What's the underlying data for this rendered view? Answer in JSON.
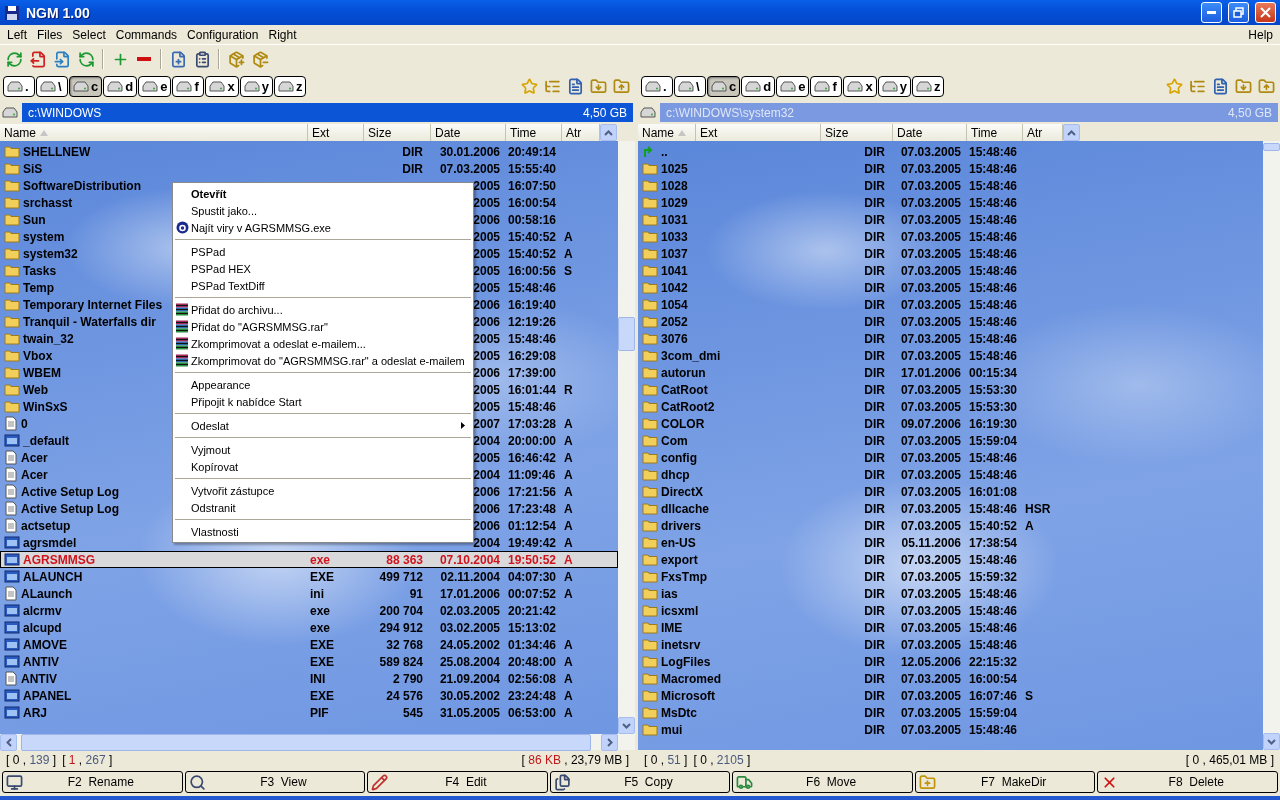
{
  "window": {
    "title": "NGM 1.00"
  },
  "menu": {
    "left": [
      "Left",
      "Files",
      "Select",
      "Commands",
      "Configuration",
      "Right"
    ],
    "right": [
      "Help"
    ]
  },
  "panes": [
    {
      "active": true,
      "path": "c:\\WINDOWS",
      "free": "4,50 GB",
      "drives": [
        {
          "label": ".",
          "selected": false
        },
        {
          "label": "\\",
          "selected": false
        },
        {
          "label": "c",
          "selected": true
        },
        {
          "label": "d",
          "selected": false
        },
        {
          "label": "e",
          "selected": false
        },
        {
          "label": "f",
          "selected": false
        },
        {
          "label": "x",
          "selected": false
        },
        {
          "label": "y",
          "selected": false
        },
        {
          "label": "z",
          "selected": false
        }
      ],
      "columns": [
        {
          "label": "Name",
          "sorted": true
        },
        {
          "label": "Ext",
          "sorted": false
        },
        {
          "label": "Size",
          "sorted": false
        },
        {
          "label": "Date",
          "sorted": false
        },
        {
          "label": "Time",
          "sorted": false
        },
        {
          "label": "Atr",
          "sorted": false
        }
      ],
      "rows": [
        {
          "kind": "folder",
          "name": "SHELLNEW",
          "size": "DIR",
          "date": "30.01.2006",
          "time": "20:49:14",
          "selected": false
        },
        {
          "kind": "folder",
          "name": "SiS",
          "size": "DIR",
          "date": "07.03.2005",
          "time": "15:55:40",
          "selected": false
        },
        {
          "kind": "folder",
          "name": "SoftwareDistribution",
          "date": "2005",
          "time": "16:07:50",
          "selected": false
        },
        {
          "kind": "folder",
          "name": "srchasst",
          "date": "2005",
          "time": "16:00:54",
          "selected": false
        },
        {
          "kind": "folder",
          "name": "Sun",
          "date": "2006",
          "time": "00:58:16",
          "selected": false
        },
        {
          "kind": "folder",
          "name": "system",
          "date": "2005",
          "time": "15:40:52",
          "attr": "A",
          "selected": false
        },
        {
          "kind": "folder",
          "name": "system32",
          "date": "2005",
          "time": "15:40:52",
          "attr": "A",
          "selected": false
        },
        {
          "kind": "folder",
          "name": "Tasks",
          "date": "2005",
          "time": "16:00:56",
          "attr": "S",
          "selected": false
        },
        {
          "kind": "folder",
          "name": "Temp",
          "date": "2005",
          "time": "15:48:46",
          "selected": false
        },
        {
          "kind": "folder",
          "name": "Temporary Internet Files",
          "date": "2006",
          "time": "16:19:40",
          "selected": false
        },
        {
          "kind": "folder",
          "name": "Tranquil - Waterfalls dir",
          "date": "2006",
          "time": "12:19:26",
          "selected": false
        },
        {
          "kind": "folder",
          "name": "twain_32",
          "date": "2005",
          "time": "15:48:46",
          "selected": false
        },
        {
          "kind": "folder",
          "name": "Vbox",
          "date": "2005",
          "time": "16:29:08",
          "selected": false
        },
        {
          "kind": "folder",
          "name": "WBEM",
          "date": "2006",
          "time": "17:39:00",
          "selected": false
        },
        {
          "kind": "folder",
          "name": "Web",
          "date": "2005",
          "time": "16:01:44",
          "attr": "R",
          "selected": false
        },
        {
          "kind": "folder",
          "name": "WinSxS",
          "date": "2005",
          "time": "15:48:46",
          "selected": false
        },
        {
          "kind": "file",
          "name": "0",
          "date": "2007",
          "time": "17:03:28",
          "attr": "A",
          "selected": false
        },
        {
          "kind": "app",
          "name": "_default",
          "date": "2004",
          "time": "20:00:00",
          "attr": "A",
          "selected": false
        },
        {
          "kind": "file",
          "name": "Acer",
          "date": "2005",
          "time": "16:46:42",
          "attr": "A",
          "selected": false
        },
        {
          "kind": "file",
          "name": "Acer",
          "date": "2004",
          "time": "11:09:46",
          "attr": "A",
          "selected": false
        },
        {
          "kind": "file",
          "name": "Active Setup Log",
          "date": "2006",
          "time": "17:21:56",
          "attr": "A",
          "selected": false
        },
        {
          "kind": "file",
          "name": "Active Setup Log",
          "date": "2006",
          "time": "17:23:48",
          "attr": "A",
          "selected": false
        },
        {
          "kind": "file",
          "name": "actsetup",
          "date": "2006",
          "time": "01:12:54",
          "attr": "A",
          "selected": false
        },
        {
          "kind": "app",
          "name": "agrsmdel",
          "date": "2004",
          "time": "19:49:42",
          "attr": "A",
          "selected": false
        },
        {
          "kind": "app",
          "name": "AGRSMMSG",
          "ext": "exe",
          "size": "88 363",
          "date": "07.10.2004",
          "time": "19:50:52",
          "attr": "A",
          "selected": true
        },
        {
          "kind": "app",
          "name": "ALAUNCH",
          "ext": "EXE",
          "size": "499 712",
          "date": "02.11.2004",
          "time": "04:07:30",
          "attr": "A",
          "selected": false
        },
        {
          "kind": "file",
          "name": "ALaunch",
          "ext": "ini",
          "size": "91",
          "date": "17.01.2006",
          "time": "00:07:52",
          "attr": "A",
          "selected": false
        },
        {
          "kind": "app",
          "name": "alcrmv",
          "ext": "exe",
          "size": "200 704",
          "date": "02.03.2005",
          "time": "20:21:42",
          "selected": false
        },
        {
          "kind": "app",
          "name": "alcupd",
          "ext": "exe",
          "size": "294 912",
          "date": "03.02.2005",
          "time": "15:13:02",
          "selected": false
        },
        {
          "kind": "app",
          "name": "AMOVE",
          "ext": "EXE",
          "size": "32 768",
          "date": "24.05.2002",
          "time": "01:34:46",
          "attr": "A",
          "selected": false
        },
        {
          "kind": "app",
          "name": "ANTIV",
          "ext": "EXE",
          "size": "589 824",
          "date": "25.08.2004",
          "time": "20:48:00",
          "attr": "A",
          "selected": false
        },
        {
          "kind": "file",
          "name": "ANTIV",
          "ext": "INI",
          "size": "2 790",
          "date": "21.09.2004",
          "time": "02:56:08",
          "attr": "A",
          "selected": false
        },
        {
          "kind": "app",
          "name": "APANEL",
          "ext": "EXE",
          "size": "24 576",
          "date": "30.05.2002",
          "time": "23:24:48",
          "attr": "A",
          "selected": false
        },
        {
          "kind": "app",
          "name": "ARJ",
          "ext": "PIF",
          "size": "545",
          "date": "31.05.2005",
          "time": "06:53:00",
          "attr": "A",
          "selected": false
        }
      ],
      "counters": [
        {
          "parts": [
            "[",
            "0",
            ",",
            "139",
            "]"
          ],
          "marked": false
        },
        {
          "parts": [
            "[",
            "1",
            ",",
            "267",
            "]"
          ],
          "marked": true
        }
      ],
      "totals": {
        "parts": [
          "[",
          "86 KB",
          ",",
          "23,79 MB",
          "]"
        ],
        "marked": true
      }
    },
    {
      "active": false,
      "path": "c:\\WINDOWS\\system32",
      "free": "4,50 GB",
      "drives": [
        {
          "label": ".",
          "selected": false
        },
        {
          "label": "\\",
          "selected": false
        },
        {
          "label": "c",
          "selected": true
        },
        {
          "label": "d",
          "selected": false
        },
        {
          "label": "e",
          "selected": false
        },
        {
          "label": "f",
          "selected": false
        },
        {
          "label": "x",
          "selected": false
        },
        {
          "label": "y",
          "selected": false
        },
        {
          "label": "z",
          "selected": false
        }
      ],
      "columns": [
        {
          "label": "Name",
          "sorted": true
        },
        {
          "label": "Ext",
          "sorted": false
        },
        {
          "label": "Size",
          "sorted": false
        },
        {
          "label": "Date",
          "sorted": false
        },
        {
          "label": "Time",
          "sorted": false
        },
        {
          "label": "Atr",
          "sorted": false
        }
      ],
      "rows": [
        {
          "kind": "parent",
          "name": "..",
          "size": "DIR",
          "date": "07.03.2005",
          "time": "15:48:46",
          "selected": false
        },
        {
          "kind": "folder",
          "name": "1025",
          "size": "DIR",
          "date": "07.03.2005",
          "time": "15:48:46",
          "selected": false
        },
        {
          "kind": "folder",
          "name": "1028",
          "size": "DIR",
          "date": "07.03.2005",
          "time": "15:48:46",
          "selected": false
        },
        {
          "kind": "folder",
          "name": "1029",
          "size": "DIR",
          "date": "07.03.2005",
          "time": "15:48:46",
          "selected": false
        },
        {
          "kind": "folder",
          "name": "1031",
          "size": "DIR",
          "date": "07.03.2005",
          "time": "15:48:46",
          "selected": false
        },
        {
          "kind": "folder",
          "name": "1033",
          "size": "DIR",
          "date": "07.03.2005",
          "time": "15:48:46",
          "selected": false
        },
        {
          "kind": "folder",
          "name": "1037",
          "size": "DIR",
          "date": "07.03.2005",
          "time": "15:48:46",
          "selected": false
        },
        {
          "kind": "folder",
          "name": "1041",
          "size": "DIR",
          "date": "07.03.2005",
          "time": "15:48:46",
          "selected": false
        },
        {
          "kind": "folder",
          "name": "1042",
          "size": "DIR",
          "date": "07.03.2005",
          "time": "15:48:46",
          "selected": false
        },
        {
          "kind": "folder",
          "name": "1054",
          "size": "DIR",
          "date": "07.03.2005",
          "time": "15:48:46",
          "selected": false
        },
        {
          "kind": "folder",
          "name": "2052",
          "size": "DIR",
          "date": "07.03.2005",
          "time": "15:48:46",
          "selected": false
        },
        {
          "kind": "folder",
          "name": "3076",
          "size": "DIR",
          "date": "07.03.2005",
          "time": "15:48:46",
          "selected": false
        },
        {
          "kind": "folder",
          "name": "3com_dmi",
          "size": "DIR",
          "date": "07.03.2005",
          "time": "15:48:46",
          "selected": false
        },
        {
          "kind": "folder",
          "name": "autorun",
          "size": "DIR",
          "date": "17.01.2006",
          "time": "00:15:34",
          "selected": false
        },
        {
          "kind": "folder",
          "name": "CatRoot",
          "size": "DIR",
          "date": "07.03.2005",
          "time": "15:53:30",
          "selected": false
        },
        {
          "kind": "folder",
          "name": "CatRoot2",
          "size": "DIR",
          "date": "07.03.2005",
          "time": "15:53:30",
          "selected": false
        },
        {
          "kind": "folder",
          "name": "COLOR",
          "size": "DIR",
          "date": "09.07.2006",
          "time": "16:19:30",
          "selected": false
        },
        {
          "kind": "folder",
          "name": "Com",
          "size": "DIR",
          "date": "07.03.2005",
          "time": "15:59:04",
          "selected": false
        },
        {
          "kind": "folder",
          "name": "config",
          "size": "DIR",
          "date": "07.03.2005",
          "time": "15:48:46",
          "selected": false
        },
        {
          "kind": "folder",
          "name": "dhcp",
          "size": "DIR",
          "date": "07.03.2005",
          "time": "15:48:46",
          "selected": false
        },
        {
          "kind": "folder",
          "name": "DirectX",
          "size": "DIR",
          "date": "07.03.2005",
          "time": "16:01:08",
          "selected": false
        },
        {
          "kind": "folder",
          "name": "dllcache",
          "size": "DIR",
          "date": "07.03.2005",
          "time": "15:48:46",
          "attr": "HSR",
          "selected": false
        },
        {
          "kind": "folder",
          "name": "drivers",
          "size": "DIR",
          "date": "07.03.2005",
          "time": "15:40:52",
          "attr": "A",
          "selected": false
        },
        {
          "kind": "folder",
          "name": "en-US",
          "size": "DIR",
          "date": "05.11.2006",
          "time": "17:38:54",
          "selected": false
        },
        {
          "kind": "folder",
          "name": "export",
          "size": "DIR",
          "date": "07.03.2005",
          "time": "15:48:46",
          "selected": false
        },
        {
          "kind": "folder",
          "name": "FxsTmp",
          "size": "DIR",
          "date": "07.03.2005",
          "time": "15:59:32",
          "selected": false
        },
        {
          "kind": "folder",
          "name": "ias",
          "size": "DIR",
          "date": "07.03.2005",
          "time": "15:48:46",
          "selected": false
        },
        {
          "kind": "folder",
          "name": "icsxml",
          "size": "DIR",
          "date": "07.03.2005",
          "time": "15:48:46",
          "selected": false
        },
        {
          "kind": "folder",
          "name": "IME",
          "size": "DIR",
          "date": "07.03.2005",
          "time": "15:48:46",
          "selected": false
        },
        {
          "kind": "folder",
          "name": "inetsrv",
          "size": "DIR",
          "date": "07.03.2005",
          "time": "15:48:46",
          "selected": false
        },
        {
          "kind": "folder",
          "name": "LogFiles",
          "size": "DIR",
          "date": "12.05.2006",
          "time": "22:15:32",
          "selected": false
        },
        {
          "kind": "folder",
          "name": "Macromed",
          "size": "DIR",
          "date": "07.03.2005",
          "time": "16:00:54",
          "selected": false
        },
        {
          "kind": "folder",
          "name": "Microsoft",
          "size": "DIR",
          "date": "07.03.2005",
          "time": "16:07:46",
          "attr": "S",
          "selected": false
        },
        {
          "kind": "folder",
          "name": "MsDtc",
          "size": "DIR",
          "date": "07.03.2005",
          "time": "15:59:04",
          "selected": false
        },
        {
          "kind": "folder",
          "name": "mui",
          "size": "DIR",
          "date": "07.03.2005",
          "time": "15:48:46",
          "selected": false
        }
      ],
      "counters": [
        {
          "parts": [
            "[",
            "0",
            ",",
            "51",
            "]"
          ],
          "marked": false
        },
        {
          "parts": [
            "[",
            "0",
            ",",
            "2105",
            "]"
          ],
          "marked": false
        }
      ],
      "totals": {
        "parts": [
          "[",
          "0",
          ",",
          "465,01 MB",
          "]"
        ],
        "marked": false
      }
    }
  ],
  "context_menu": {
    "items": [
      {
        "kind": "item",
        "label": "Otevřít",
        "default": true
      },
      {
        "kind": "item",
        "label": "Spustit jako...",
        "default": false
      },
      {
        "kind": "antivirus",
        "label": "Najít viry v AGRSMMSG.exe",
        "default": false
      },
      {
        "kind": "separator"
      },
      {
        "kind": "item",
        "label": "PSPad",
        "default": false
      },
      {
        "kind": "item",
        "label": "PSPad HEX",
        "default": false
      },
      {
        "kind": "item",
        "label": "PSPad TextDiff",
        "default": false
      },
      {
        "kind": "separator"
      },
      {
        "kind": "archive",
        "label": "Přidat do archivu...",
        "default": false
      },
      {
        "kind": "archive",
        "label": "Přidat do \"AGRSMMSG.rar\"",
        "default": false
      },
      {
        "kind": "archive",
        "label": "Zkomprimovat a odeslat e-mailem...",
        "default": false
      },
      {
        "kind": "archive",
        "label": "Zkomprimovat do \"AGRSMMSG.rar\" a odeslat e-mailem",
        "default": false
      },
      {
        "kind": "separator"
      },
      {
        "kind": "item",
        "label": "Appearance",
        "default": false
      },
      {
        "kind": "item",
        "label": "Připojit k nabídce Start",
        "default": false
      },
      {
        "kind": "separator"
      },
      {
        "kind": "submenu",
        "label": "Odeslat",
        "default": false
      },
      {
        "kind": "separator"
      },
      {
        "kind": "item",
        "label": "Vyjmout",
        "default": false
      },
      {
        "kind": "item",
        "label": "Kopírovat",
        "default": false
      },
      {
        "kind": "separator"
      },
      {
        "kind": "item",
        "label": "Vytvořit zástupce",
        "default": false
      },
      {
        "kind": "item",
        "label": "Odstranit",
        "default": false
      },
      {
        "kind": "separator"
      },
      {
        "kind": "item",
        "label": "Vlastnosti",
        "default": false
      }
    ]
  },
  "function_keys": [
    {
      "kind": "rename",
      "key": "F2",
      "label": "Rename"
    },
    {
      "kind": "view",
      "key": "F3",
      "label": "View"
    },
    {
      "kind": "edit",
      "key": "F4",
      "label": "Edit"
    },
    {
      "kind": "copy",
      "key": "F5",
      "label": "Copy"
    },
    {
      "kind": "move",
      "key": "F6",
      "label": "Move"
    },
    {
      "kind": "makedir",
      "key": "F7",
      "label": "MakeDir"
    },
    {
      "kind": "delete",
      "key": "F8",
      "label": "Delete"
    }
  ]
}
